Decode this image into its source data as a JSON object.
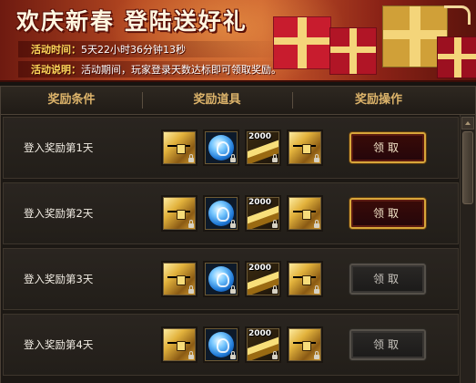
{
  "banner": {
    "title": "欢庆新春 登陆送好礼",
    "time_label": "活动时间：",
    "time_value": "5天22小时36分钟13秒",
    "desc_label": "活动说明：",
    "desc_value": "活动期间，玩家登录天数达标即可领取奖励。"
  },
  "table": {
    "headers": [
      "奖励条件",
      "奖励道具",
      "奖励操作"
    ]
  },
  "rows": [
    {
      "condition": "登入奖励第1天",
      "button": "领取",
      "button_state": "active",
      "items": [
        {
          "icon": "treasure-chest-icon",
          "qty": "",
          "locked": true
        },
        {
          "icon": "blue-orb-icon",
          "qty": "",
          "locked": true
        },
        {
          "icon": "gold-ingot-icon",
          "qty": "2000",
          "locked": true
        },
        {
          "icon": "treasure-chest-icon",
          "qty": "",
          "locked": true
        }
      ]
    },
    {
      "condition": "登入奖励第2天",
      "button": "领取",
      "button_state": "active",
      "items": [
        {
          "icon": "treasure-chest-icon",
          "qty": "",
          "locked": true
        },
        {
          "icon": "blue-orb-icon",
          "qty": "",
          "locked": true
        },
        {
          "icon": "gold-ingot-icon",
          "qty": "2000",
          "locked": true
        },
        {
          "icon": "treasure-chest-icon",
          "qty": "",
          "locked": true
        }
      ]
    },
    {
      "condition": "登入奖励第3天",
      "button": "领取",
      "button_state": "disabled",
      "items": [
        {
          "icon": "treasure-chest-icon",
          "qty": "",
          "locked": true
        },
        {
          "icon": "blue-orb-icon",
          "qty": "",
          "locked": true
        },
        {
          "icon": "gold-ingot-icon",
          "qty": "2000",
          "locked": true
        },
        {
          "icon": "treasure-chest-icon",
          "qty": "",
          "locked": true
        }
      ]
    },
    {
      "condition": "登入奖励第4天",
      "button": "领取",
      "button_state": "disabled",
      "items": [
        {
          "icon": "treasure-chest-icon",
          "qty": "",
          "locked": true
        },
        {
          "icon": "blue-orb-icon",
          "qty": "",
          "locked": true
        },
        {
          "icon": "gold-ingot-icon",
          "qty": "2000",
          "locked": true
        },
        {
          "icon": "treasure-chest-icon",
          "qty": "",
          "locked": true
        }
      ]
    }
  ],
  "colors": {
    "header_text": "#dcb36a",
    "button_active_border": "#d8a63a",
    "button_disabled_border": "#555049",
    "banner_label": "#ffd85a"
  }
}
